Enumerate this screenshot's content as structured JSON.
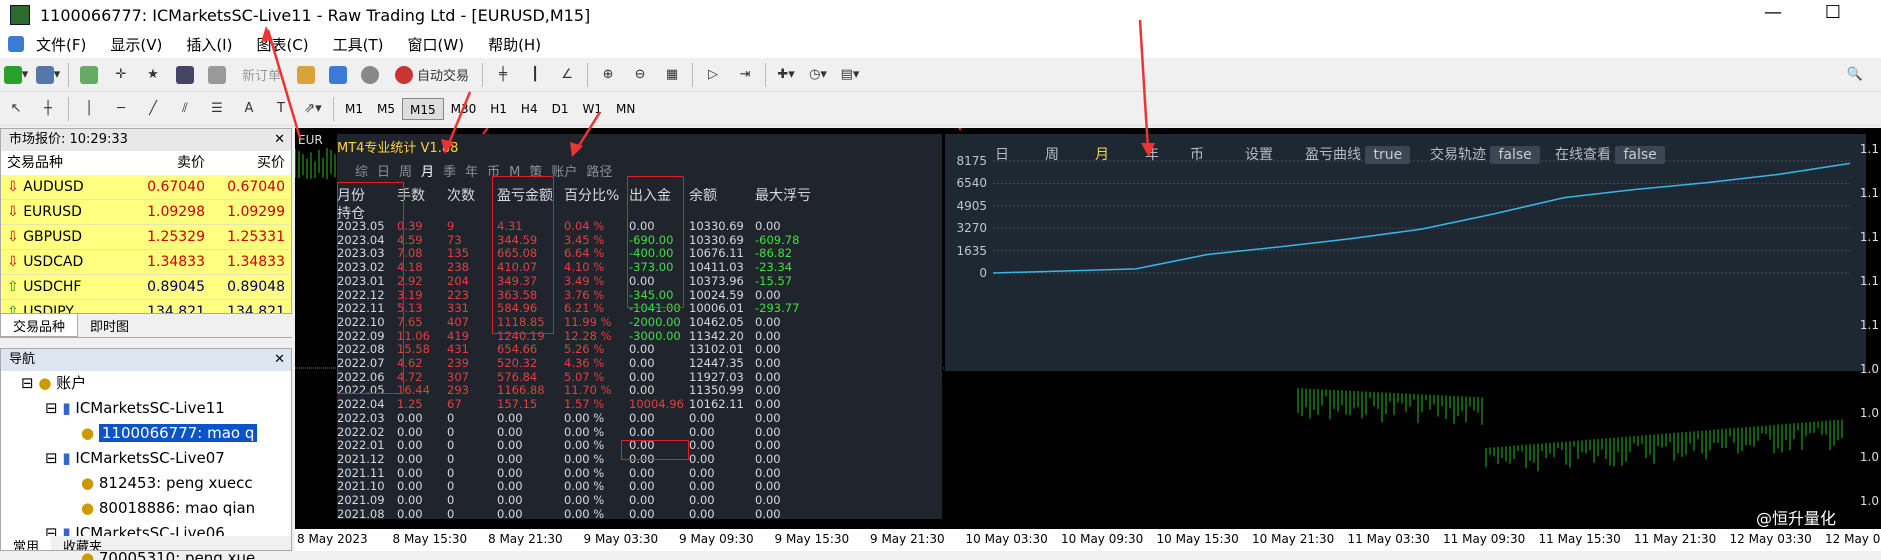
{
  "window": {
    "title": "1100066777: ICMarketsSC-Live11 - Raw Trading Ltd - [EURUSD,M15]",
    "min": "—",
    "max": "☐"
  },
  "menu": [
    "文件(F)",
    "显示(V)",
    "插入(I)",
    "图表(C)",
    "工具(T)",
    "窗口(W)",
    "帮助(H)"
  ],
  "toolbar": {
    "new_order": "新订单",
    "auto_trade": "自动交易"
  },
  "timeframes": [
    "M1",
    "M5",
    "M15",
    "M30",
    "H1",
    "H4",
    "D1",
    "W1",
    "MN"
  ],
  "timeframe_selected": "M15",
  "market_watch": {
    "title": "市场报价: 10:29:33",
    "headers": [
      "交易品种",
      "卖价",
      "买价"
    ],
    "rows": [
      {
        "symbol": "AUDUSD",
        "bid": "0.67040",
        "ask": "0.67040",
        "dir": "down"
      },
      {
        "symbol": "EURUSD",
        "bid": "1.09298",
        "ask": "1.09299",
        "dir": "down"
      },
      {
        "symbol": "GBPUSD",
        "bid": "1.25329",
        "ask": "1.25331",
        "dir": "down"
      },
      {
        "symbol": "USDCAD",
        "bid": "1.34833",
        "ask": "1.34833",
        "dir": "down"
      },
      {
        "symbol": "USDCHF",
        "bid": "0.89045",
        "ask": "0.89048",
        "dir": "up"
      },
      {
        "symbol": "USDJPY",
        "bid": "134.821",
        "ask": "134.821",
        "dir": "up"
      }
    ],
    "tabs": [
      "交易品种",
      "即时图"
    ]
  },
  "navigator": {
    "title": "导航",
    "items": [
      "账户",
      "ICMarketsSC-Live11",
      "1100066777: mao q",
      "ICMarketsSC-Live07",
      "812453: peng xuecc",
      "80018886: mao qian",
      "ICMarketsSC-Live06",
      "70005310: peng xue"
    ],
    "tabs": [
      "常用",
      "收藏夹"
    ]
  },
  "chart": {
    "symbol_label": "EUR",
    "stats_title": "MT4专业统计 V1.88",
    "stats_menu": [
      "综",
      "日",
      "周",
      "月",
      "季",
      "年",
      "币",
      "M",
      "策",
      "账户",
      "路径"
    ],
    "stats_menu_active": "月",
    "headers": [
      "月份",
      "手数",
      "次数",
      "盈亏金额",
      "百分比%",
      "出入金",
      "余额",
      "最大浮亏"
    ],
    "sub_header": "持仓",
    "rows": [
      [
        "2023.05",
        "0.39",
        "9",
        "4.31",
        "0.04 %",
        "0.00",
        "10330.69",
        "0.00"
      ],
      [
        "2023.04",
        "4.59",
        "73",
        "344.59",
        "3.45 %",
        "-690.00",
        "10330.69",
        "-609.78"
      ],
      [
        "2023.03",
        "7.08",
        "135",
        "665.08",
        "6.64 %",
        "-400.00",
        "10676.11",
        "-86.82"
      ],
      [
        "2023.02",
        "4.18",
        "238",
        "410.07",
        "4.10 %",
        "-373.00",
        "10411.03",
        "-23.34"
      ],
      [
        "2023.01",
        "2.92",
        "204",
        "349.37",
        "3.49 %",
        "0.00",
        "10373.96",
        "-15.57"
      ],
      [
        "2022.12",
        "3.19",
        "223",
        "363.58",
        "3.76 %",
        "-345.00",
        "10024.59",
        "0.00"
      ],
      [
        "2022.11",
        "5.13",
        "331",
        "584.96",
        "6.21 %",
        "-1041.00",
        "10006.01",
        "-293.77"
      ],
      [
        "2022.10",
        "7.65",
        "407",
        "1118.85",
        "11.99 %",
        "-2000.00",
        "10462.05",
        "0.00"
      ],
      [
        "2022.09",
        "11.06",
        "419",
        "1240.19",
        "12.28 %",
        "-3000.00",
        "11342.20",
        "0.00"
      ],
      [
        "2022.08",
        "15.58",
        "431",
        "654.66",
        "5.26 %",
        "0.00",
        "13102.01",
        "0.00"
      ],
      [
        "2022.07",
        "4.62",
        "239",
        "520.32",
        "4.36 %",
        "0.00",
        "12447.35",
        "0.00"
      ],
      [
        "2022.06",
        "4.72",
        "307",
        "576.84",
        "5.07 %",
        "0.00",
        "11927.03",
        "0.00"
      ],
      [
        "2022.05",
        "16.44",
        "293",
        "1166.88",
        "11.70 %",
        "0.00",
        "11350.99",
        "0.00"
      ],
      [
        "2022.04",
        "1.25",
        "67",
        "157.15",
        "1.57 %",
        "10004.96",
        "10162.11",
        "0.00"
      ],
      [
        "2022.03",
        "0.00",
        "0",
        "0.00",
        "0.00 %",
        "0.00",
        "0.00",
        "0.00"
      ],
      [
        "2022.02",
        "0.00",
        "0",
        "0.00",
        "0.00 %",
        "0.00",
        "0.00",
        "0.00"
      ],
      [
        "2022.01",
        "0.00",
        "0",
        "0.00",
        "0.00 %",
        "0.00",
        "0.00",
        "0.00"
      ],
      [
        "2021.12",
        "0.00",
        "0",
        "0.00",
        "0.00 %",
        "0.00",
        "0.00",
        "0.00"
      ],
      [
        "2021.11",
        "0.00",
        "0",
        "0.00",
        "0.00 %",
        "0.00",
        "0.00",
        "0.00"
      ],
      [
        "2021.10",
        "0.00",
        "0",
        "0.00",
        "0.00 %",
        "0.00",
        "0.00",
        "0.00"
      ],
      [
        "2021.09",
        "0.00",
        "0",
        "0.00",
        "0.00 %",
        "0.00",
        "0.00",
        "0.00"
      ],
      [
        "2021.08",
        "0.00",
        "0",
        "0.00",
        "0.00 %",
        "0.00",
        "0.00",
        "0.00"
      ]
    ],
    "right_panel": {
      "tabs": [
        "日",
        "周",
        "月",
        "年",
        "币",
        "设置"
      ],
      "active_tab": "月",
      "options": [
        {
          "label": "盈亏曲线",
          "value": "true"
        },
        {
          "label": "交易轨迹",
          "value": "false"
        },
        {
          "label": "在线查看",
          "value": "false"
        }
      ],
      "y_ticks": [
        "8175",
        "6540",
        "4905",
        "3270",
        "1635",
        "0"
      ]
    },
    "price_ticks": [
      "1.1",
      "1.1",
      "1.1",
      "1.1",
      "1.1",
      "1.0",
      "1.0",
      "1.0",
      "1.0"
    ],
    "x_labels": [
      "8 May 2023",
      "8 May 15:30",
      "8 May 21:30",
      "9 May 03:30",
      "9 May 09:30",
      "9 May 15:30",
      "9 May 21:30",
      "10 May 03:30",
      "10 May 09:30",
      "10 May 15:30",
      "10 May 21:30",
      "11 May 03:30",
      "11 May 09:30",
      "11 May 15:30",
      "11 May 21:30",
      "12 May 03:30",
      "12 May 0"
    ]
  },
  "watermark": "@恒升量化",
  "chart_data": {
    "type": "line",
    "series": [
      {
        "values": [
          0,
          150,
          300,
          1350,
          1900,
          2500,
          3200,
          4300,
          5500,
          6100,
          6600,
          7200,
          8000
        ]
      }
    ],
    "ylim": [
      0,
      8175
    ],
    "y_ticks": [
      0,
      1635,
      3270,
      4905,
      6540,
      8175
    ]
  }
}
